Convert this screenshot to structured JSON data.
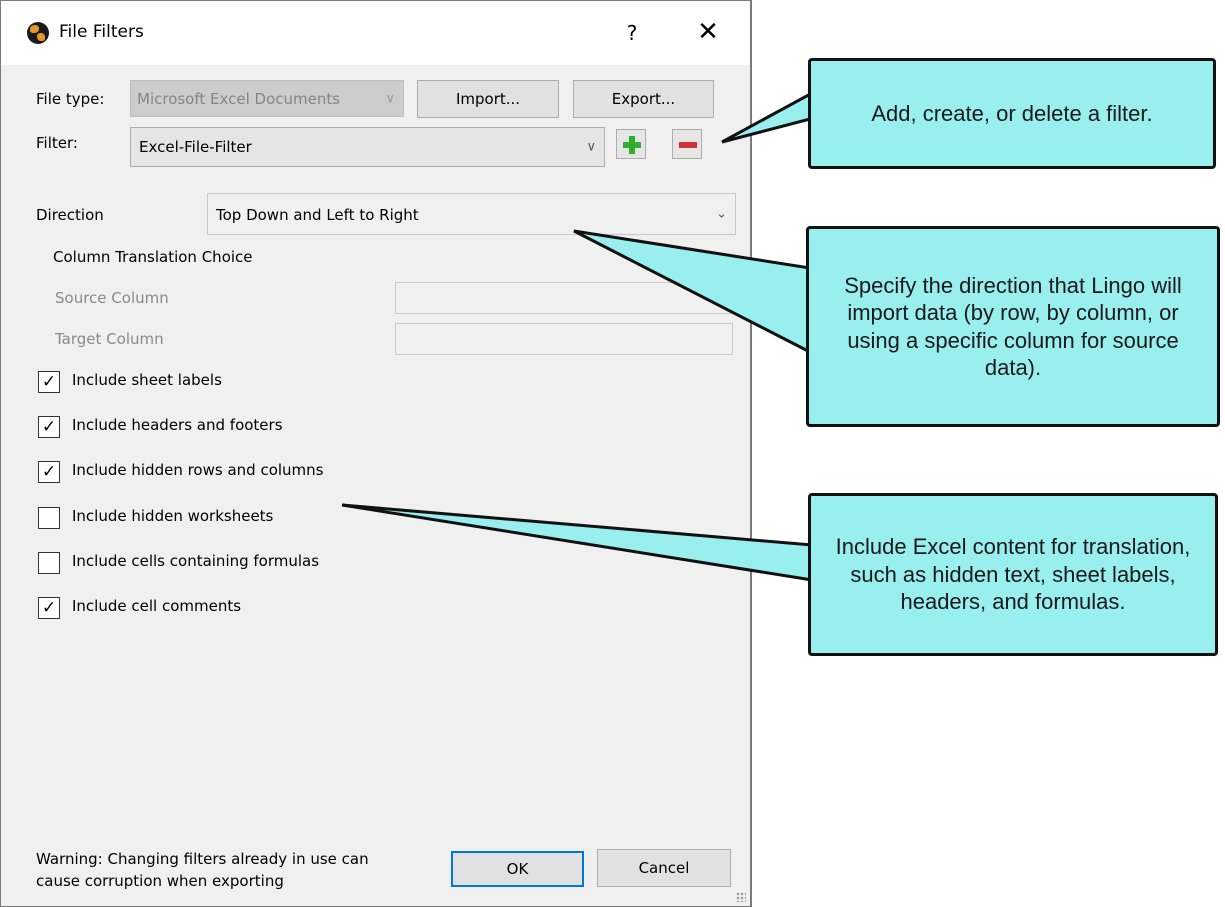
{
  "window": {
    "title": "File Filters",
    "help_label": "?",
    "close_label": "✕"
  },
  "file_type": {
    "label": "File type:",
    "value": "Microsoft Excel Documents",
    "chevron": "∨"
  },
  "buttons": {
    "import": "Import...",
    "export": "Export...",
    "ok": "OK",
    "cancel": "Cancel"
  },
  "filter": {
    "label": "Filter:",
    "value": "Excel-File-Filter",
    "chevron": "∨",
    "add_icon": "plus-icon",
    "delete_icon": "minus-icon"
  },
  "direction": {
    "label": "Direction",
    "value": "Top Down and Left to Right",
    "chevron": "⌄"
  },
  "column_choice": {
    "heading": "Column Translation Choice",
    "source_label": "Source Column",
    "target_label": "Target Column"
  },
  "options": [
    {
      "label": "Include sheet labels",
      "checked": true
    },
    {
      "label": "Include headers and footers",
      "checked": true
    },
    {
      "label": "Include hidden rows and columns",
      "checked": true
    },
    {
      "label": "Include hidden worksheets",
      "checked": false
    },
    {
      "label": "Include cells containing formulas",
      "checked": false
    },
    {
      "label": "Include cell comments",
      "checked": true
    }
  ],
  "warning": {
    "line1": "Warning: Changing filters already in use can",
    "line2": "cause corruption when exporting"
  },
  "callouts": {
    "filter": "Add, create, or delete a filter.",
    "direction": "Specify the direction that Lingo will import data (by row, by column, or using a specific column for source data).",
    "content": "Include Excel content for translation, such as hidden text, sheet labels, headers, and formulas."
  },
  "colors": {
    "callout_fill": "#99eeee",
    "add_green": "#2fae2f",
    "delete_red": "#d32f3a",
    "default_button_border": "#0078d7"
  }
}
